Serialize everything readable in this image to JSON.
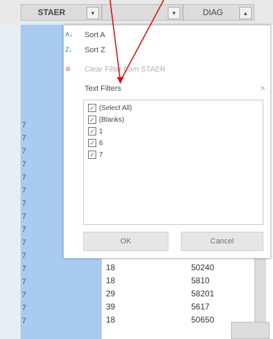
{
  "header": {
    "col_b": "STAER",
    "col_c_arrow": "▾",
    "col_d": "DIAG",
    "dd_b": "▾",
    "dd_d": "▴"
  },
  "filter_menu": {
    "sort_a": "Sort A",
    "sort_z": "Sort Z",
    "clear": "Clear Filter from STAER",
    "text_filters": "Text Filters",
    "text_filters_arrow": ">",
    "items": [
      {
        "label": "(Select All)",
        "checked": true
      },
      {
        "label": "(Blanks)",
        "checked": true
      },
      {
        "label": "1",
        "checked": true
      },
      {
        "label": "6",
        "checked": true
      },
      {
        "label": "7",
        "checked": true
      }
    ],
    "ok": "OK",
    "cancel": "Cancel"
  },
  "rows": [
    {
      "b": "7"
    },
    {
      "b": "7"
    },
    {
      "b": "7"
    },
    {
      "b": "7"
    },
    {
      "b": "7"
    },
    {
      "b": "7"
    },
    {
      "b": "7"
    },
    {
      "b": "7"
    },
    {
      "b": "7"
    },
    {
      "b": "7"
    },
    {
      "b": "7"
    },
    {
      "b": "7",
      "c": "18",
      "d": "50240"
    },
    {
      "b": "7",
      "c": "18",
      "d": "5810"
    },
    {
      "b": "7",
      "c": "29",
      "d": "58201"
    },
    {
      "b": "7",
      "c": "39",
      "d": "5617"
    },
    {
      "b": "7",
      "c": "18",
      "d": "50650"
    }
  ],
  "colors": {
    "accent": "#2f6fbf",
    "highlight": "#a9cbef",
    "arrow": "#e01010"
  }
}
